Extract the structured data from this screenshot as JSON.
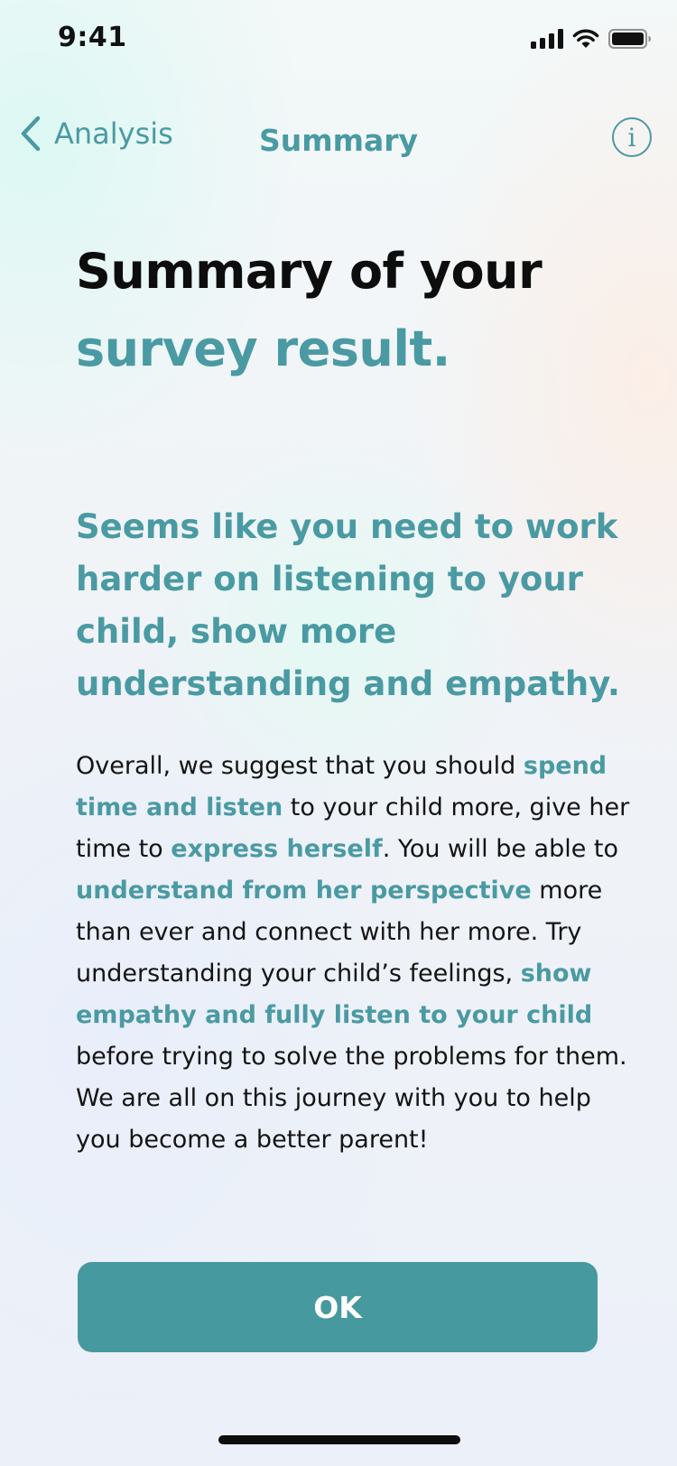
{
  "status_bar": {
    "time": "9:41",
    "icons": [
      "cellular-signal-icon",
      "wifi-icon",
      "battery-icon"
    ]
  },
  "nav": {
    "back_label": "Analysis",
    "title": "Summary",
    "info_glyph": "i"
  },
  "headline": {
    "line1": "Summary of your",
    "line2": "survey result."
  },
  "subheading": "Seems like you need to work harder on listening to your child, show more understanding and empathy.",
  "body": {
    "p1": "Overall, we suggest that you should ",
    "h1": "spend time and listen",
    "p2": " to your child more, give her time to ",
    "h2": "express herself",
    "p3": ". You will be able to ",
    "h3": "understand from her perspective",
    "p4": " more than ever and connect with her more. Try understanding your child’s feelings, ",
    "h4": "show empathy and fully listen to your child",
    "p5": " before trying to solve the problems for them. We are all on this journey with you to help you become a better parent!"
  },
  "ok_button": {
    "label": "OK"
  },
  "colors": {
    "accent": "#4a9aa3",
    "button": "#46999e",
    "text": "#111111"
  }
}
